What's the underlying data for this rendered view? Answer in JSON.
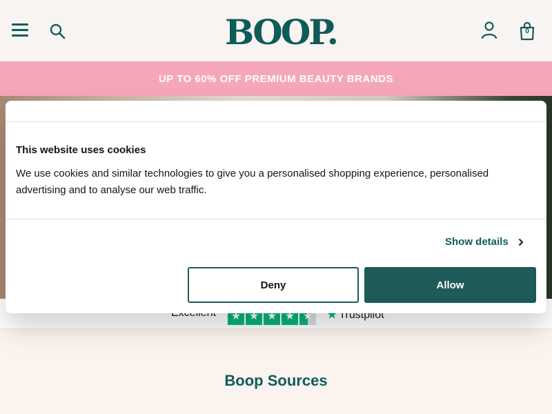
{
  "header": {
    "logo_text": "BOOP.",
    "bag_count": "0"
  },
  "promo": {
    "text": "UP TO 60% OFF PREMIUM BEAUTY BRANDS"
  },
  "trustpilot": {
    "rating_label": "Excellent",
    "brand": "Trustpilot",
    "stars": 4.5
  },
  "sources": {
    "title": "Boop Sources"
  },
  "cookie_modal": {
    "title": "This website uses cookies",
    "body": "We use cookies and similar technologies to give you a personalised shopping experience, personalised advertising and to analyse our web traffic.",
    "show_details_label": "Show details",
    "deny_label": "Deny",
    "allow_label": "Allow"
  },
  "colors": {
    "brand": "#0e5c5a",
    "promo_bg": "#f5a7b8",
    "trustpilot_green": "#00b67a",
    "allow_button": "#1d5a58"
  }
}
